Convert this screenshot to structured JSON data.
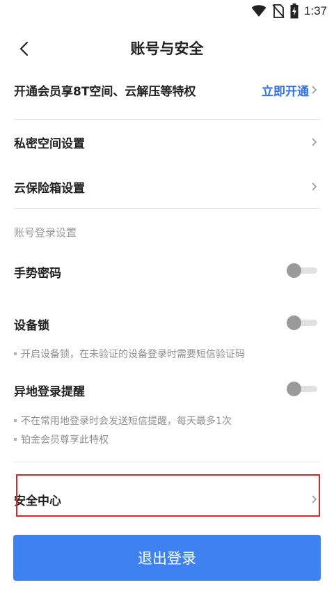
{
  "statusbar": {
    "time": "1:37"
  },
  "header": {
    "title": "账号与安全"
  },
  "vip": {
    "text": "开通会员享8T空间、云解压等特权",
    "link": "立即开通"
  },
  "settings": {
    "private_space": "私密空间设置",
    "safe_box": "云保险箱设置"
  },
  "login_section": {
    "title": "账号登录设置",
    "gesture": {
      "label": "手势密码",
      "on": false
    },
    "device_lock": {
      "label": "设备锁",
      "on": false,
      "note": "开启设备锁，在未验证的设备登录时需要短信验证码"
    },
    "remote_login": {
      "label": "异地登录提醒",
      "on": false,
      "notes": [
        "不在常用地登录时会发送短信提醒，每天最多1次",
        "铂金会员尊享此特权"
      ]
    }
  },
  "security_center": {
    "label": "安全中心"
  },
  "logout": {
    "label": "退出登录"
  },
  "colors": {
    "accent": "#2f6ff0",
    "button": "#3d82f0",
    "highlight": "#e32424"
  },
  "icons": [
    "wifi-icon",
    "no-sim-icon",
    "battery-charging-icon",
    "back-arrow-icon",
    "chevron-right-icon"
  ]
}
